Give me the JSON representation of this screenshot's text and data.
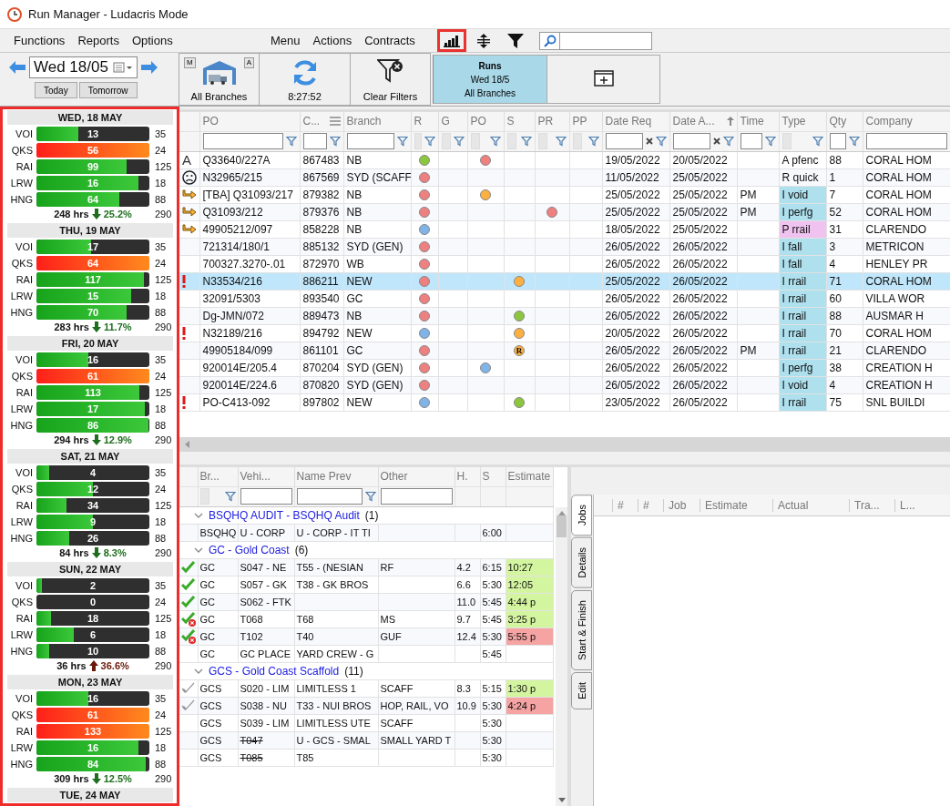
{
  "window": {
    "title": "Run Manager - Ludacris Mode"
  },
  "menu_left": [
    "Functions",
    "Reports",
    "Options"
  ],
  "menu_center": [
    "Menu",
    "Actions",
    "Contracts"
  ],
  "toolbar_icons": [
    {
      "kind": "chart",
      "highlighted": true
    },
    {
      "kind": "expand",
      "highlighted": false
    },
    {
      "kind": "filter",
      "highlighted": false
    }
  ],
  "date_nav": {
    "date": "Wed 18/05",
    "buttons": [
      "Today",
      "Tomorrow"
    ]
  },
  "toolbar": [
    {
      "kind": "branches",
      "label": "All Branches",
      "badges": [
        "M",
        "A"
      ]
    },
    {
      "kind": "refresh",
      "label": "8:27:52"
    },
    {
      "kind": "clear_filters",
      "label": "Clear Filters"
    },
    {
      "kind": "runs",
      "lines": [
        "Runs",
        "Wed 18/5",
        "All Branches"
      ],
      "selected": true
    },
    {
      "kind": "new_window",
      "selected": false
    }
  ],
  "days": [
    {
      "label": "WED, 18 MAY",
      "bars": [
        {
          "code": "VOI",
          "value": "13",
          "capacity": "35",
          "level": 0.37,
          "over_capacity": false
        },
        {
          "code": "QKS",
          "value": "56",
          "capacity": "24",
          "level": 1,
          "over_capacity": true
        },
        {
          "code": "RAI",
          "value": "99",
          "capacity": "125",
          "level": 0.8,
          "over_capacity": false
        },
        {
          "code": "LRW",
          "value": "16",
          "capacity": "18",
          "level": 0.9,
          "over_capacity": false
        },
        {
          "code": "HNG",
          "value": "64",
          "capacity": "88",
          "level": 0.73,
          "over_capacity": false
        }
      ],
      "hours": "248 hrs",
      "rising": false,
      "percent": "25.2%",
      "total": "290"
    },
    {
      "label": "THU, 19 MAY",
      "bars": [
        {
          "code": "VOI",
          "value": "17",
          "capacity": "35",
          "level": 0.48,
          "over_capacity": false
        },
        {
          "code": "QKS",
          "value": "64",
          "capacity": "24",
          "level": 1,
          "over_capacity": true
        },
        {
          "code": "RAI",
          "value": "117",
          "capacity": "125",
          "level": 0.95,
          "over_capacity": false
        },
        {
          "code": "LRW",
          "value": "15",
          "capacity": "18",
          "level": 0.84,
          "over_capacity": false
        },
        {
          "code": "HNG",
          "value": "70",
          "capacity": "88",
          "level": 0.8,
          "over_capacity": false
        }
      ],
      "hours": "283 hrs",
      "rising": false,
      "percent": "11.7%",
      "total": "290"
    },
    {
      "label": "FRI, 20 MAY",
      "bars": [
        {
          "code": "VOI",
          "value": "16",
          "capacity": "35",
          "level": 0.46,
          "over_capacity": false
        },
        {
          "code": "QKS",
          "value": "61",
          "capacity": "24",
          "level": 1,
          "over_capacity": true
        },
        {
          "code": "RAI",
          "value": "113",
          "capacity": "125",
          "level": 0.91,
          "over_capacity": false
        },
        {
          "code": "LRW",
          "value": "17",
          "capacity": "18",
          "level": 0.96,
          "over_capacity": false
        },
        {
          "code": "HNG",
          "value": "86",
          "capacity": "88",
          "level": 0.99,
          "over_capacity": false
        }
      ],
      "hours": "294 hrs",
      "rising": false,
      "percent": "12.9%",
      "total": "290"
    },
    {
      "label": "SAT, 21 MAY",
      "bars": [
        {
          "code": "VOI",
          "value": "4",
          "capacity": "35",
          "level": 0.11,
          "over_capacity": false
        },
        {
          "code": "QKS",
          "value": "12",
          "capacity": "24",
          "level": 0.5,
          "over_capacity": false
        },
        {
          "code": "RAI",
          "value": "34",
          "capacity": "125",
          "level": 0.27,
          "over_capacity": false
        },
        {
          "code": "LRW",
          "value": "9",
          "capacity": "18",
          "level": 0.5,
          "over_capacity": false
        },
        {
          "code": "HNG",
          "value": "26",
          "capacity": "88",
          "level": 0.29,
          "over_capacity": false
        }
      ],
      "hours": "84 hrs",
      "rising": false,
      "percent": "8.3%",
      "total": "290"
    },
    {
      "label": "SUN, 22 MAY",
      "bars": [
        {
          "code": "VOI",
          "value": "2",
          "capacity": "35",
          "level": 0.05,
          "over_capacity": false
        },
        {
          "code": "QKS",
          "value": "0",
          "capacity": "24",
          "level": 0,
          "over_capacity": false
        },
        {
          "code": "RAI",
          "value": "18",
          "capacity": "125",
          "level": 0.13,
          "over_capacity": false
        },
        {
          "code": "LRW",
          "value": "6",
          "capacity": "18",
          "level": 0.33,
          "over_capacity": false
        },
        {
          "code": "HNG",
          "value": "10",
          "capacity": "88",
          "level": 0.11,
          "over_capacity": false
        }
      ],
      "hours": "36 hrs",
      "rising": true,
      "percent": "36.6%",
      "total": "290"
    },
    {
      "label": "MON, 23 MAY",
      "bars": [
        {
          "code": "VOI",
          "value": "16",
          "capacity": "35",
          "level": 0.46,
          "over_capacity": false
        },
        {
          "code": "QKS",
          "value": "61",
          "capacity": "24",
          "level": 1,
          "over_capacity": true
        },
        {
          "code": "RAI",
          "value": "133",
          "capacity": "125",
          "level": 1,
          "over_capacity": true
        },
        {
          "code": "LRW",
          "value": "16",
          "capacity": "18",
          "level": 0.9,
          "over_capacity": false
        },
        {
          "code": "HNG",
          "value": "84",
          "capacity": "88",
          "level": 0.97,
          "over_capacity": false
        }
      ],
      "hours": "309 hrs",
      "rising": false,
      "percent": "12.5%",
      "total": "290"
    },
    {
      "label": "TUE, 24 MAY"
    }
  ],
  "orders": {
    "columns": [
      {
        "label": "PO",
        "filter": {
          "kind": "input_funnel"
        }
      },
      {
        "label": "C...",
        "filter": {
          "kind": "input_funnel"
        },
        "menu": true
      },
      {
        "label": "Branch",
        "filter": {
          "kind": "input_funnel"
        }
      },
      {
        "label": "R",
        "filter": {
          "kind": "flag_funnel"
        }
      },
      {
        "label": "G",
        "filter": {
          "kind": "flag_funnel"
        }
      },
      {
        "label": "PO",
        "filter": {
          "kind": "flag_funnel"
        }
      },
      {
        "label": "S",
        "filter": {
          "kind": "flag_funnel"
        }
      },
      {
        "label": "PR",
        "filter": {
          "kind": "flag_funnel"
        }
      },
      {
        "label": "PP",
        "filter": {
          "kind": "flag_funnel"
        }
      },
      {
        "label": "Date Req",
        "filter": {
          "kind": "date"
        }
      },
      {
        "label": "Date A...",
        "filter": {
          "kind": "date"
        },
        "sort": {
          "kind": "asc"
        }
      },
      {
        "label": "Time",
        "filter": {
          "kind": "input_funnel"
        }
      },
      {
        "label": "Type",
        "filter": {
          "kind": "flag_funnel"
        }
      },
      {
        "label": "Qty",
        "filter": {
          "kind": "input_funnel"
        }
      },
      {
        "label": "Company",
        "filter": {
          "kind": "input"
        }
      }
    ],
    "rows": [
      {
        "marker": {
          "kind": "letter",
          "text": "A"
        },
        "po": "Q33640/227A",
        "c": "867483",
        "branch": "NB",
        "dots": {
          "r": {
            "color": "#8cc63f"
          },
          "po": {
            "color": "#ef8080"
          }
        },
        "date_req": "19/05/2022",
        "date_a": "20/05/2022",
        "type": {
          "text": "A pfenc"
        },
        "qty": "88",
        "company": "CORAL HOM",
        "selected": false
      },
      {
        "marker": {
          "kind": "sad"
        },
        "po": "N32965/215",
        "c": "867569",
        "branch": "SYD (SCAFF",
        "dots": {
          "r": {
            "color": "#ef8080"
          }
        },
        "date_req": "11/05/2022",
        "date_a": "25/05/2022",
        "type": {
          "text": "R quick"
        },
        "qty": "1",
        "company": "CORAL HOM",
        "selected": false
      },
      {
        "marker": {
          "kind": "arrow"
        },
        "po": "[TBA] Q31093/217",
        "c": "879382",
        "branch": "NB",
        "dots": {
          "r": {
            "color": "#ef8080"
          },
          "po": {
            "color": "#fbb040"
          }
        },
        "date_req": "25/05/2022",
        "date_a": "25/05/2022",
        "time": "PM",
        "type": {
          "text": "I void",
          "color": "#aee0ee"
        },
        "qty": "7",
        "company": "CORAL HOM",
        "selected": false
      },
      {
        "marker": {
          "kind": "arrow"
        },
        "po": "Q31093/212",
        "c": "879376",
        "branch": "NB",
        "dots": {
          "r": {
            "color": "#ef8080"
          },
          "pr": {
            "color": "#ef8080"
          }
        },
        "date_req": "25/05/2022",
        "date_a": "25/05/2022",
        "time": "PM",
        "type": {
          "text": "I perfg",
          "color": "#aee0ee"
        },
        "qty": "52",
        "company": "CORAL HOM",
        "selected": false
      },
      {
        "marker": {
          "kind": "arrow"
        },
        "po": "49905212/097",
        "c": "858228",
        "branch": "NB",
        "dots": {
          "r": {
            "color": "#80b4e8"
          }
        },
        "date_req": "18/05/2022",
        "date_a": "25/05/2022",
        "type": {
          "text": "P rrail",
          "color": "#f0c2f0"
        },
        "qty": "31",
        "company": "CLARENDO",
        "selected": false
      },
      {
        "po": "721314/180/1",
        "c": "885132",
        "branch": "SYD (GEN)",
        "dots": {
          "r": {
            "color": "#ef8080"
          }
        },
        "date_req": "26/05/2022",
        "date_a": "26/05/2022",
        "type": {
          "text": "I fall",
          "color": "#aee0ee"
        },
        "qty": "3",
        "company": "METRICON",
        "selected": false
      },
      {
        "po": "700327.3270-.01",
        "c": "872970",
        "branch": "WB",
        "dots": {
          "r": {
            "color": "#ef8080"
          }
        },
        "date_req": "26/05/2022",
        "date_a": "26/05/2022",
        "type": {
          "text": "I fall",
          "color": "#aee0ee"
        },
        "qty": "4",
        "company": "HENLEY PR",
        "selected": false
      },
      {
        "marker": {
          "kind": "alert"
        },
        "po": "N33534/216",
        "c": "886211",
        "branch": "NEW",
        "dots": {
          "r": {
            "color": "#ef8080"
          },
          "s": {
            "color": "#fbb040"
          }
        },
        "date_req": "25/05/2022",
        "date_a": "26/05/2022",
        "type": {
          "text": "I rrail",
          "color": "#aee0ee"
        },
        "qty": "71",
        "company": "CORAL HOM",
        "selected": true
      },
      {
        "po": "32091/5303",
        "c": "893540",
        "branch": "GC",
        "dots": {
          "r": {
            "color": "#ef8080"
          }
        },
        "date_req": "26/05/2022",
        "date_a": "26/05/2022",
        "type": {
          "text": "I rrail",
          "color": "#aee0ee"
        },
        "qty": "60",
        "company": "VILLA WOR",
        "selected": false
      },
      {
        "po": "Dg-JMN/072",
        "c": "889473",
        "branch": "NB",
        "dots": {
          "r": {
            "color": "#ef8080"
          },
          "s": {
            "color": "#8cc63f"
          }
        },
        "date_req": "26/05/2022",
        "date_a": "26/05/2022",
        "type": {
          "text": "I rrail",
          "color": "#aee0ee"
        },
        "qty": "88",
        "company": "AUSMAR H",
        "selected": false
      },
      {
        "marker": {
          "kind": "alert"
        },
        "po": "N32189/216",
        "c": "894792",
        "branch": "NEW",
        "dots": {
          "r": {
            "color": "#80b4e8"
          },
          "s": {
            "color": "#fbb040"
          }
        },
        "date_req": "20/05/2022",
        "date_a": "26/05/2022",
        "type": {
          "text": "I rrail",
          "color": "#aee0ee"
        },
        "qty": "70",
        "company": "CORAL HOM",
        "selected": false
      },
      {
        "po": "49905184/099",
        "c": "861101",
        "branch": "GC",
        "dots": {
          "r": {
            "color": "#ef8080"
          },
          "s": {
            "color": "#fbb040",
            "label": "R"
          }
        },
        "date_req": "26/05/2022",
        "date_a": "26/05/2022",
        "time": "PM",
        "type": {
          "text": "I rrail",
          "color": "#aee0ee"
        },
        "qty": "21",
        "company": "CLARENDO",
        "selected": false
      },
      {
        "po": "920014E/205.4",
        "c": "870204",
        "branch": "SYD (GEN)",
        "dots": {
          "r": {
            "color": "#ef8080"
          },
          "po": {
            "color": "#80b4e8"
          }
        },
        "date_req": "26/05/2022",
        "date_a": "26/05/2022",
        "type": {
          "text": "I perfg",
          "color": "#aee0ee"
        },
        "qty": "38",
        "company": "CREATION H",
        "selected": false
      },
      {
        "po": "920014E/224.6",
        "c": "870820",
        "branch": "SYD (GEN)",
        "dots": {
          "r": {
            "color": "#ef8080"
          }
        },
        "date_req": "26/05/2022",
        "date_a": "26/05/2022",
        "type": {
          "text": "I void",
          "color": "#aee0ee"
        },
        "qty": "4",
        "company": "CREATION H",
        "selected": false
      },
      {
        "marker": {
          "kind": "alert"
        },
        "po": "PO-C413-092",
        "c": "897802",
        "branch": "NEW",
        "dots": {
          "r": {
            "color": "#80b4e8"
          },
          "s": {
            "color": "#8cc63f"
          }
        },
        "date_req": "23/05/2022",
        "date_a": "26/05/2022",
        "type": {
          "text": "I rrail",
          "color": "#aee0ee"
        },
        "qty": "75",
        "company": "SNL BUILDI",
        "selected": false
      }
    ]
  },
  "runs": {
    "columns": [
      {
        "label": "Br...",
        "filter": {
          "kind": "flag_funnel"
        }
      },
      {
        "label": "Vehi...",
        "filter": {
          "kind": "input"
        }
      },
      {
        "label": "Name Prev",
        "filter": {
          "kind": "input_funnel"
        }
      },
      {
        "label": "Other",
        "filter": {
          "kind": "input"
        }
      },
      {
        "label": "H."
      },
      {
        "label": "S"
      },
      {
        "label": "Estimate"
      }
    ],
    "groups": [
      {
        "name": "BSQHQ AUDIT - BSQHQ Audit",
        "count": "(1)",
        "expanded": true,
        "rows": [
          {
            "branch": "BSQHQ",
            "vehicle": "U - CORP",
            "vehicle_struck": false,
            "name_prev": "U - CORP - IT TI",
            "s": "6:00"
          }
        ]
      },
      {
        "name": "GC - Gold Coast",
        "count": "(6)",
        "expanded": true,
        "rows": [
          {
            "check": {
              "kind": "done"
            },
            "branch": "GC",
            "vehicle": "S047 - NE",
            "vehicle_struck": false,
            "name_prev": "T55 - (NESIAN",
            "other": "RF",
            "h": "4.2",
            "s": "6:15",
            "estimate": {
              "text": "10:27",
              "color": "#d4f5a0"
            }
          },
          {
            "check": {
              "kind": "done"
            },
            "branch": "GC",
            "vehicle": "S057 - GK",
            "vehicle_struck": false,
            "name_prev": "T38 - GK BROS",
            "h": "6.6",
            "s": "5:30",
            "estimate": {
              "text": "12:05",
              "color": "#d4f5a0"
            }
          },
          {
            "check": {
              "kind": "done"
            },
            "branch": "GC",
            "vehicle": "S062 - FTK",
            "vehicle_struck": false,
            "h": "11.0",
            "s": "5:45",
            "estimate": {
              "text": "4:44 p",
              "color": "#d4f5a0"
            }
          },
          {
            "check": {
              "kind": "done_error"
            },
            "branch": "GC",
            "vehicle": "T068",
            "vehicle_struck": false,
            "name_prev": "T68",
            "other": "MS",
            "h": "9.7",
            "s": "5:45",
            "estimate": {
              "text": "3:25 p",
              "color": "#d4f5a0"
            }
          },
          {
            "check": {
              "kind": "done_error"
            },
            "branch": "GC",
            "vehicle": "T102",
            "vehicle_struck": false,
            "name_prev": "T40",
            "other": "GUF",
            "h": "12.4",
            "s": "5:30",
            "estimate": {
              "text": "5:55 p",
              "color": "#f5a3a3"
            }
          },
          {
            "branch": "GC",
            "vehicle": "GC PLACE",
            "vehicle_struck": false,
            "name_prev": "YARD CREW - G",
            "s": "5:45"
          }
        ]
      },
      {
        "name": "GCS - Gold Coast Scaffold",
        "count": "(11)",
        "expanded": true,
        "rows": [
          {
            "check": {
              "kind": "pending"
            },
            "branch": "GCS",
            "vehicle": "S020 - LIM",
            "vehicle_struck": false,
            "name_prev": "LIMITLESS 1",
            "other": "SCAFF",
            "h": "8.3",
            "s": "5:15",
            "estimate": {
              "text": "1:30 p",
              "color": "#d4f5a0"
            }
          },
          {
            "check": {
              "kind": "pending"
            },
            "branch": "GCS",
            "vehicle": "S038 - NU",
            "vehicle_struck": false,
            "name_prev": "T33 - NUI BROS",
            "other": "HOP, RAIL, VO",
            "h": "10.9",
            "s": "5:30",
            "estimate": {
              "text": "4:24 p",
              "color": "#f5a3a3"
            }
          },
          {
            "branch": "GCS",
            "vehicle": "S039 - LIM",
            "vehicle_struck": false,
            "name_prev": "LIMITLESS UTE",
            "other": "SCAFF",
            "s": "5:30"
          },
          {
            "branch": "GCS",
            "vehicle": "T047",
            "vehicle_struck": true,
            "name_prev": "U - GCS - SMAL",
            "other": "SMALL YARD T",
            "s": "5:30"
          },
          {
            "branch": "GCS",
            "vehicle": "T085",
            "vehicle_struck": true,
            "name_prev": "T85",
            "s": "5:30"
          }
        ]
      }
    ]
  },
  "side_tabs": [
    {
      "label": "Jobs",
      "selected": true
    },
    {
      "label": "Details",
      "selected": false
    },
    {
      "label": "Start & Finish",
      "selected": false
    },
    {
      "label": "Edit",
      "selected": false
    }
  ],
  "jobs": {
    "columns": [
      "#",
      "#",
      "Job",
      "Estimate",
      "Actual",
      "Tra...",
      "L..."
    ]
  }
}
